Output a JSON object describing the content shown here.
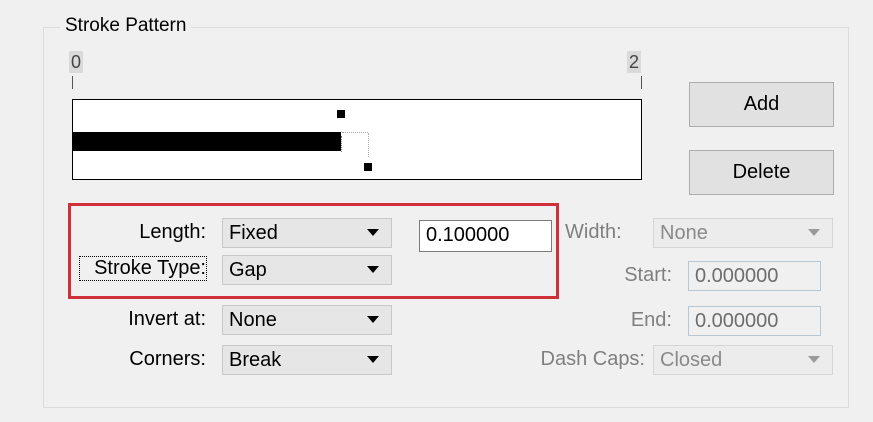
{
  "group": {
    "title": "Stroke Pattern"
  },
  "ruler": {
    "start": "0",
    "end": "2"
  },
  "buttons": {
    "add": "Add",
    "delete": "Delete"
  },
  "fields": {
    "length": {
      "label": "Length:",
      "value": "Fixed",
      "text": "0.100000"
    },
    "stroke_type": {
      "label": "Stroke Type:",
      "value": "Gap"
    },
    "invert_at": {
      "label": "Invert at:",
      "value": "None"
    },
    "corners": {
      "label": "Corners:",
      "value": "Break"
    },
    "width": {
      "label": "Width:",
      "value": "None"
    },
    "start": {
      "label": "Start:",
      "value": "0.000000"
    },
    "end": {
      "label": "End:",
      "value": "0.000000"
    },
    "dash_caps": {
      "label": "Dash Caps:",
      "value": "Closed"
    }
  },
  "colors": {
    "highlight": "#d0303a"
  },
  "icons": {
    "combo_arrow": "triangle-down-icon"
  }
}
